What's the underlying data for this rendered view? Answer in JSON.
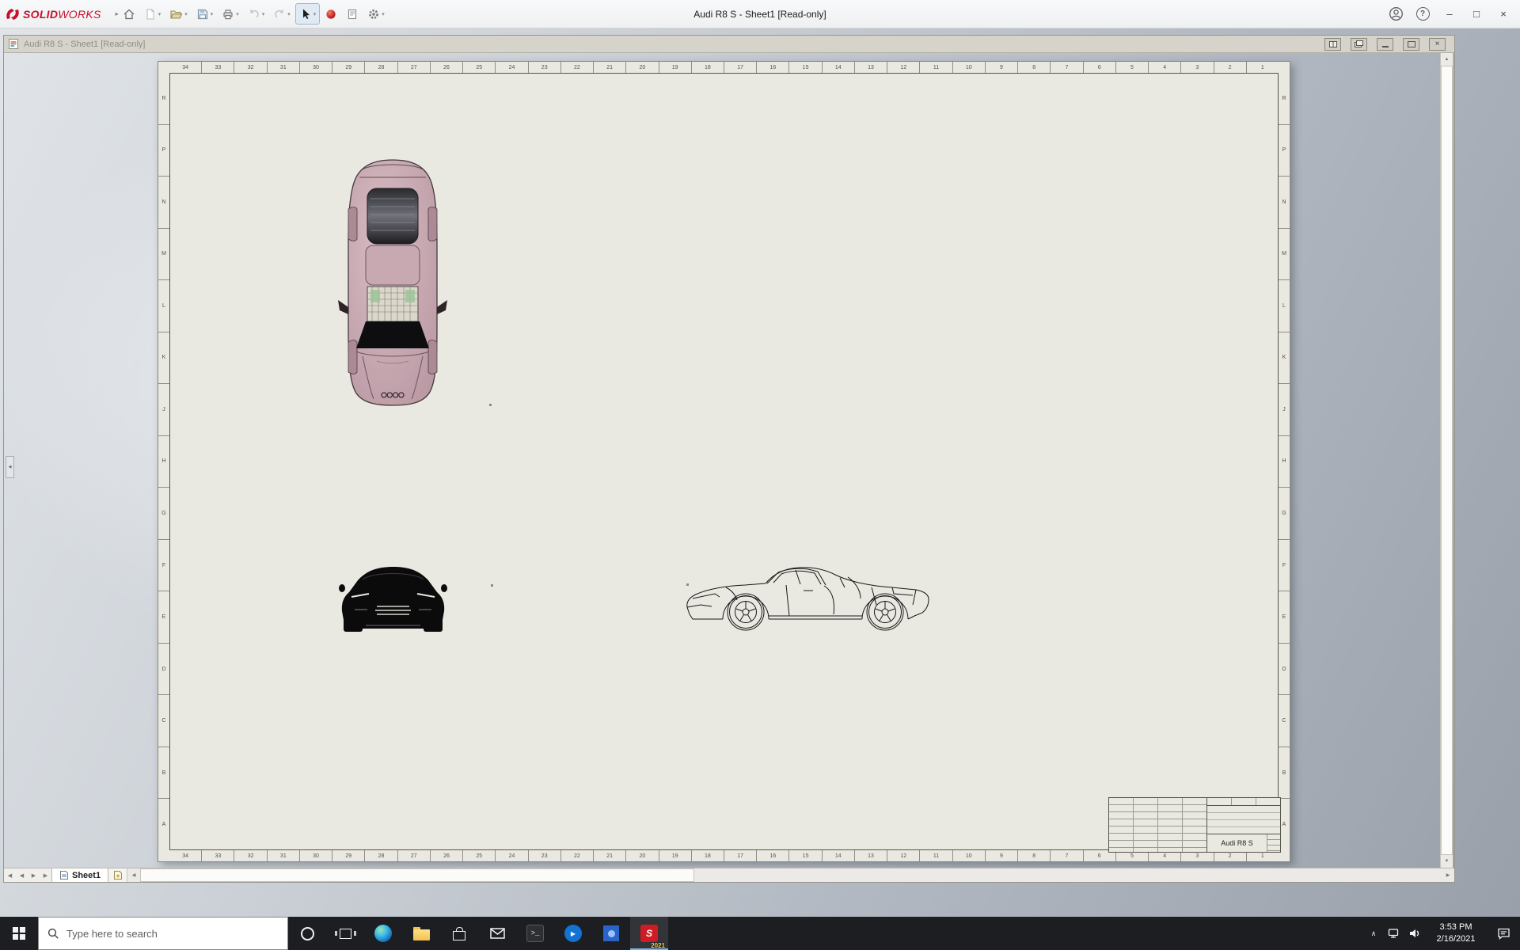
{
  "app": {
    "brand_bold": "SOLID",
    "brand_light": "WORKS",
    "title": "Audi R8 S - Sheet1 [Read-only]"
  },
  "doc": {
    "title": "Audi R8 S - Sheet1 [Read-only]"
  },
  "icons": {
    "dropdown": "▾",
    "brand_caret": "▸",
    "minimize": "–",
    "maximize": "□",
    "close": "×",
    "help": "?",
    "nav_left": "◀",
    "nav_right": "▶",
    "scroll_up": "▲",
    "scroll_down": "▼",
    "scroll_left": "◀",
    "scroll_right": "▶",
    "tray_chevron": "∧",
    "panel_collapse": "◀",
    "terminal_prompt": "&gt;_",
    "play": "▶",
    "sw_initial": "S"
  },
  "sheet": {
    "zone_numbers": [
      "34",
      "33",
      "32",
      "31",
      "30",
      "29",
      "28",
      "27",
      "26",
      "25",
      "24",
      "23",
      "22",
      "21",
      "20",
      "19",
      "18",
      "17",
      "16",
      "15",
      "14",
      "13",
      "12",
      "11",
      "10",
      "9",
      "8",
      "7",
      "6",
      "5",
      "4",
      "3",
      "2",
      "1"
    ],
    "zone_letters": [
      "R",
      "P",
      "N",
      "M",
      "L",
      "K",
      "J",
      "H",
      "G",
      "F",
      "E",
      "D",
      "C",
      "B",
      "A"
    ],
    "title_block": {
      "model_name": "Audi R8 S"
    }
  },
  "tabs": {
    "sheet1_label": "Sheet1"
  },
  "taskbar": {
    "search_placeholder": "Type here to search",
    "time": "3:53 PM",
    "date": "2/16/2021",
    "solidworks_badge": "2021"
  }
}
